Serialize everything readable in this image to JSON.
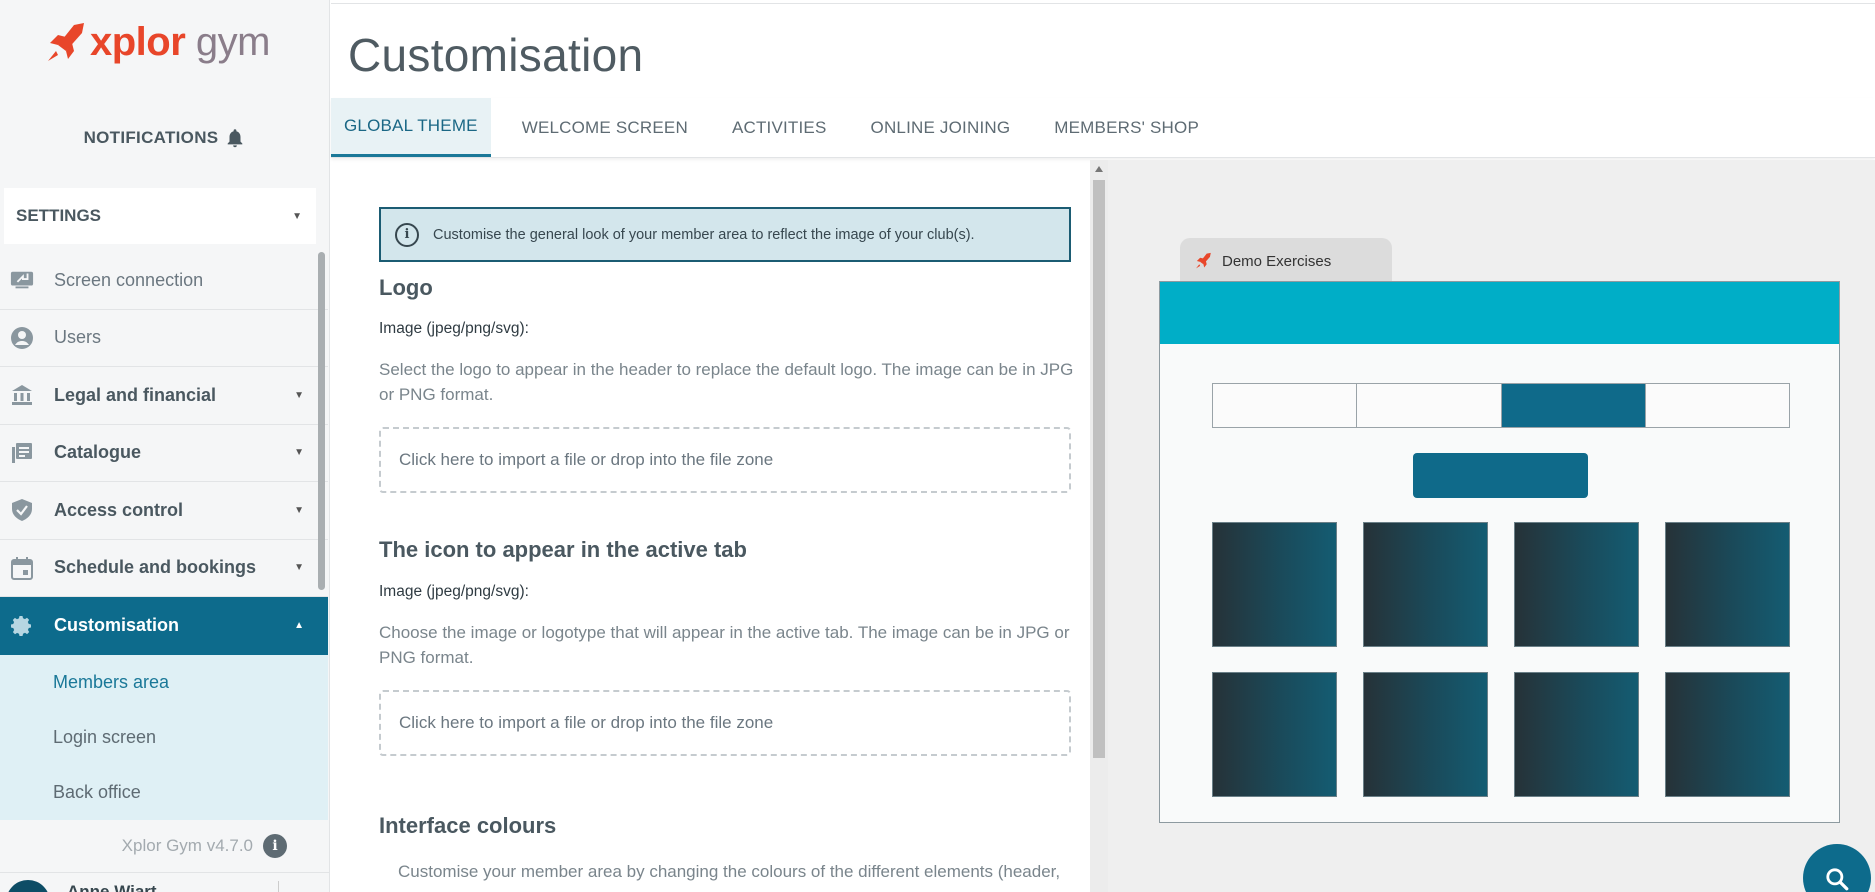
{
  "sidebar": {
    "logo": {
      "part1": "xplor",
      "part2": "gym"
    },
    "notifications_label": "NOTIFICATIONS",
    "settings_select": "SETTINGS",
    "items": [
      {
        "label": "Screen connection",
        "icon": "screen-share-icon"
      },
      {
        "label": "Users",
        "icon": "user-circle-icon"
      },
      {
        "label": "Legal and financial",
        "icon": "bank-icon"
      },
      {
        "label": "Catalogue",
        "icon": "catalogue-icon"
      },
      {
        "label": "Access control",
        "icon": "shield-check-icon"
      },
      {
        "label": "Schedule and bookings",
        "icon": "calendar-icon"
      },
      {
        "label": "Customisation",
        "icon": "gear-icon"
      }
    ],
    "sub_items": [
      {
        "label": "Members area"
      },
      {
        "label": "Login screen"
      },
      {
        "label": "Back office"
      }
    ],
    "version": "Xplor Gym v4.7.0",
    "user_name": "Anne Wiart"
  },
  "page": {
    "title": "Customisation",
    "tabs": [
      {
        "label": "GLOBAL THEME"
      },
      {
        "label": "WELCOME SCREEN"
      },
      {
        "label": "ACTIVITIES"
      },
      {
        "label": "ONLINE JOINING"
      },
      {
        "label": "MEMBERS' SHOP"
      }
    ]
  },
  "form": {
    "alert": "Customise the general look of your member area to reflect the image of your club(s).",
    "logo": {
      "heading": "Logo",
      "field_label": "Image (jpeg/png/svg):",
      "description": "Select the logo to appear in the header to replace the default logo. The image can be in JPG or PNG format.",
      "drop_label": "Click here to import a file or drop into the file zone"
    },
    "tab_icon": {
      "heading": "The icon to appear in the active tab",
      "field_label": "Image (jpeg/png/svg):",
      "description": "Choose the image or logotype that will appear in the active tab. The image can be in JPG or PNG format.",
      "drop_label": "Click here to import a file or drop into the file zone"
    },
    "colours": {
      "heading": "Interface colours",
      "description": "Customise your member area by changing the colours of the different elements (header,"
    }
  },
  "preview": {
    "tab_title": "Demo Exercises",
    "header_color": "#00aec7",
    "accent_color": "#0f6a8a"
  }
}
